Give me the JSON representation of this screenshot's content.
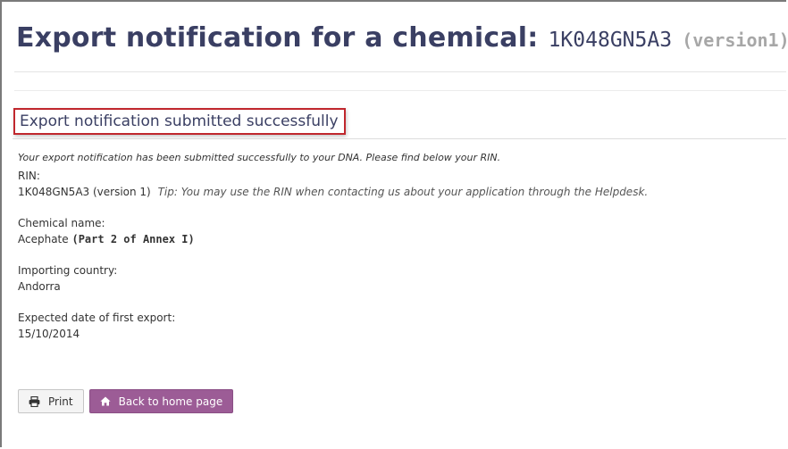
{
  "header": {
    "title": "Export notification for a chemical:",
    "rin_code": "1K048GN5A3",
    "version": "(version1)"
  },
  "success": {
    "heading": "Export notification submitted successfully",
    "message": "Your export notification has been submitted successfully to your DNA. Please find below your RIN."
  },
  "rin": {
    "label": "RIN:",
    "value": "1K048GN5A3 (version 1)",
    "tip": "Tip: You may use the RIN when contacting us about your application through the Helpdesk."
  },
  "chemical": {
    "label": "Chemical name:",
    "name": "Acephate",
    "annex": "(Part 2 of Annex I)"
  },
  "country": {
    "label": "Importing country:",
    "value": "Andorra"
  },
  "export_date": {
    "label": "Expected date of first export:",
    "value": "15/10/2014"
  },
  "actions": {
    "print_label": "Print",
    "print_icon": "printer-icon",
    "home_label": "Back to home page",
    "home_icon": "home-icon"
  },
  "colors": {
    "title": "#3a3f63",
    "highlight_border": "#c0272d",
    "home_button": "#9c5c96"
  }
}
